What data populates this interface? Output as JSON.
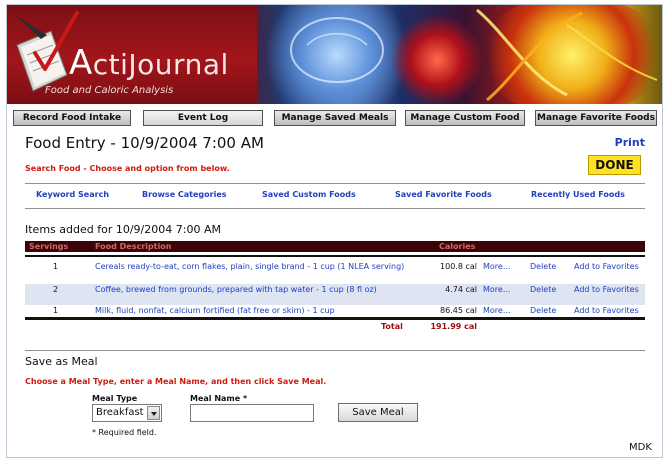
{
  "app": {
    "name_initial": "A",
    "name_rest": "ctiJournal",
    "subtitle": "Food and Caloric Analysis"
  },
  "tabs": [
    {
      "label": "Record Food Intake"
    },
    {
      "label": "Event Log"
    },
    {
      "label": "Manage Saved Meals"
    },
    {
      "label": "Manage Custom Food"
    },
    {
      "label": "Manage Favorite Foods"
    }
  ],
  "page": {
    "title": "Food Entry - 10/9/2004 7:00 AM",
    "print_label": "Print",
    "done_label": "DONE",
    "search_hint": "Search Food - Choose and option from below."
  },
  "search_links": [
    {
      "label": "Keyword Search"
    },
    {
      "label": "Browse Categories"
    },
    {
      "label": "Saved Custom Foods"
    },
    {
      "label": "Saved Favorite Foods"
    },
    {
      "label": "Recently Used Foods"
    }
  ],
  "items": {
    "title": "Items added for 10/9/2004 7:00 AM",
    "headers": {
      "servings": "Servings",
      "description": "Food Description",
      "calories": "Calories"
    },
    "rows": [
      {
        "servings": "1",
        "description": "Cereals ready-to-eat, corn flakes, plain, single brand - 1 cup (1 NLEA serving)",
        "calories": "100.8 cal",
        "more": "More...",
        "delete": "Delete",
        "favorite": "Add to Favorites"
      },
      {
        "servings": "2",
        "description": "Coffee, brewed from grounds, prepared with tap water - 1 cup (8 fl oz)",
        "calories": "4.74 cal",
        "more": "More...",
        "delete": "Delete",
        "favorite": "Add to Favorites"
      },
      {
        "servings": "1",
        "description": "Milk, fluid, nonfat, calcium fortified (fat free or skim) - 1 cup",
        "calories": "86.45 cal",
        "more": "More...",
        "delete": "Delete",
        "favorite": "Add to Favorites"
      }
    ],
    "total_label": "Total",
    "total_value": "191.99 cal"
  },
  "save_meal": {
    "title": "Save as Meal",
    "hint": "Choose a Meal Type, enter a Meal Name, and then click Save Meal.",
    "meal_type_label": "Meal Type",
    "meal_type_value": "Breakfast",
    "meal_name_label": "Meal Name *",
    "meal_name_value": "",
    "save_button": "Save Meal",
    "required_note": "* Required field."
  },
  "footer": {
    "credit": "MDK"
  },
  "colors": {
    "link": "#1f3fbf",
    "alert_red": "#d01b10",
    "header_bar": "#3c0408",
    "done_yellow": "#ffe022",
    "row_highlight": "#dfe4f3"
  },
  "icons": {
    "logo": "journal-checkmark-icon",
    "dropdown": "chevron-down-icon"
  }
}
